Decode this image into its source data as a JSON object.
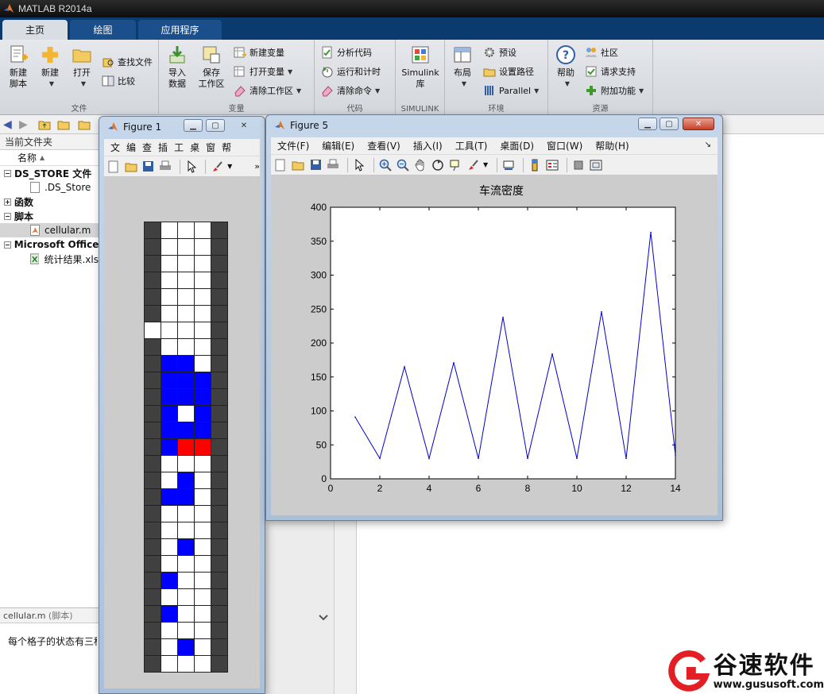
{
  "app": {
    "title": "MATLAB R2014a"
  },
  "tabs": [
    {
      "label": "主页",
      "active": true
    },
    {
      "label": "绘图",
      "active": false
    },
    {
      "label": "应用程序",
      "active": false
    }
  ],
  "ribbon": {
    "file": {
      "label": "文件",
      "new_script": "新建\n脚本",
      "new": "新建",
      "open": "打开",
      "find_files": "查找文件",
      "compare": "比较"
    },
    "variable": {
      "label": "变量",
      "import": "导入\n数据",
      "save": "保存\n工作区",
      "new_var": "新建变量",
      "open_var": "打开变量",
      "clear_ws": "清除工作区"
    },
    "code": {
      "label": "代码",
      "analyze": "分析代码",
      "run_time": "运行和计时",
      "clear_cmd": "清除命令"
    },
    "simulink": {
      "label": "SIMULINK",
      "lib": "Simulink\n库"
    },
    "env": {
      "label": "环境",
      "layout": "布局",
      "prefs": "预设",
      "set_path": "设置路径",
      "parallel": "Parallel"
    },
    "resources": {
      "label": "资源",
      "help": "帮助",
      "community": "社区",
      "support": "请求支持",
      "addons": "附加功能"
    }
  },
  "left_panel": {
    "title": "当前文件夹",
    "col_name": "名称",
    "groups": [
      {
        "label": "DS_STORE 文件",
        "expander": "−",
        "items": [
          ".DS_Store"
        ]
      },
      {
        "label": "函数",
        "expander": "+",
        "items": []
      },
      {
        "label": "脚本",
        "expander": "−",
        "items": [
          "cellular.m"
        ]
      },
      {
        "label": "Microsoft Office",
        "expander": "−",
        "items": [
          "统计结果.xls"
        ]
      }
    ],
    "detail_title": "cellular.m",
    "detail_kind": "(脚本)",
    "detail_text": "每个格子的状态有三种"
  },
  "figure1": {
    "title": "Figure 1",
    "menu": [
      "文",
      "编",
      "查",
      "插",
      "工",
      "桌",
      "窗",
      "帮"
    ],
    "grid": [
      "WEEEW",
      "WEEEW",
      "WEEEW",
      "WEEEW",
      "WEEEW",
      "WEEEW",
      "EEEEW",
      "WEEEW",
      "WCCEW",
      "WCCCW",
      "WCCCW",
      "WCECW",
      "WCCCW",
      "WCRRW",
      "WEEEW",
      "WECEW",
      "WCCEW",
      "WEEEW",
      "WEEEW",
      "WECEW",
      "WEEEW",
      "WCEEW",
      "WEEEW",
      "WCEEW",
      "WEEEW",
      "WECEW",
      "WEEEW"
    ],
    "colors": {
      "wall": "#404040",
      "empty": "#ffffff",
      "car": "#0000ff",
      "red": "#ff0000"
    }
  },
  "figure5": {
    "title": "Figure 5",
    "menu": [
      "文件(F)",
      "编辑(E)",
      "查看(V)",
      "插入(I)",
      "工具(T)",
      "桌面(D)",
      "窗口(W)",
      "帮助(H)"
    ]
  },
  "chart_data": {
    "type": "line",
    "title": "车流密度",
    "xlabel": "",
    "ylabel": "",
    "xlim": [
      0,
      14
    ],
    "ylim": [
      0,
      400
    ],
    "xticks": [
      0,
      2,
      4,
      6,
      8,
      10,
      12,
      14
    ],
    "yticks": [
      0,
      50,
      100,
      150,
      200,
      250,
      300,
      350,
      400
    ],
    "grid": false,
    "color": "#0000cc",
    "x": [
      1,
      2,
      3,
      4,
      5,
      6,
      7,
      8,
      9,
      10,
      11,
      12,
      13,
      14
    ],
    "y": [
      91,
      30,
      165,
      30,
      171,
      30,
      238,
      30,
      184,
      30,
      246,
      30,
      363,
      35
    ]
  },
  "watermark": {
    "name": "谷速软件",
    "url": "www.gususoft.com"
  }
}
